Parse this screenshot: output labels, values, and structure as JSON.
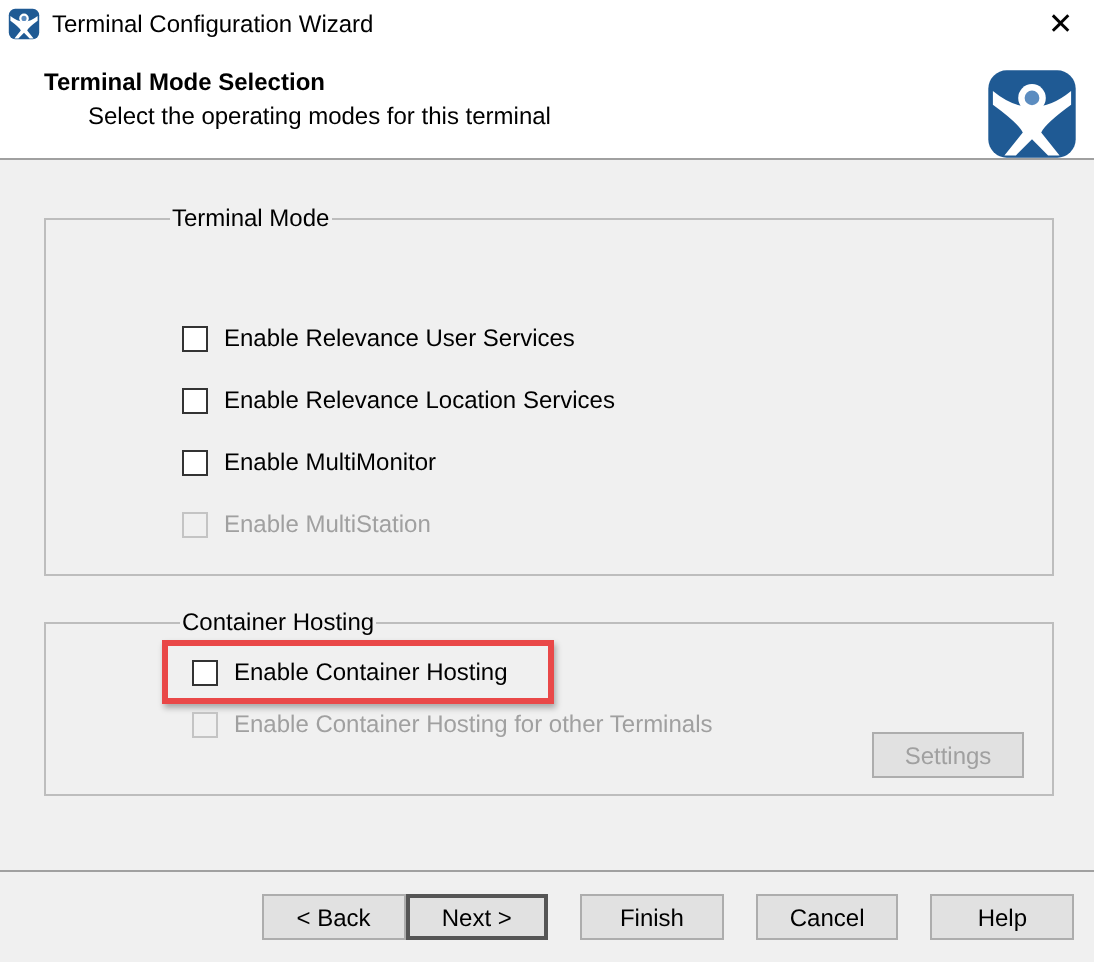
{
  "window": {
    "title": "Terminal Configuration Wizard",
    "close": "✕"
  },
  "header": {
    "title": "Terminal Mode Selection",
    "subtitle": "Select the operating modes for this terminal"
  },
  "groups": [
    {
      "title": "Terminal Mode",
      "options": [
        {
          "label": "Enable Relevance User Services",
          "checked": false,
          "disabled": false,
          "highlighted": false
        },
        {
          "label": "Enable Relevance Location Services",
          "checked": false,
          "disabled": false,
          "highlighted": false
        },
        {
          "label": "Enable MultiMonitor",
          "checked": false,
          "disabled": false,
          "highlighted": false
        },
        {
          "label": "Enable MultiStation",
          "checked": false,
          "disabled": true,
          "highlighted": false
        }
      ]
    },
    {
      "title": "Container Hosting",
      "options": [
        {
          "label": "Enable Container Hosting",
          "checked": false,
          "disabled": false,
          "highlighted": true
        },
        {
          "label": "Enable Container Hosting for other Terminals",
          "checked": false,
          "disabled": true,
          "highlighted": false
        }
      ],
      "buttons": [
        {
          "label": "Settings",
          "disabled": true
        }
      ]
    }
  ],
  "buttons": [
    {
      "label": "< Back",
      "default": false,
      "gap_after": false
    },
    {
      "label": "Next >",
      "default": true,
      "gap_after": true
    },
    {
      "label": "Finish",
      "default": false,
      "gap_after": true
    },
    {
      "label": "Cancel",
      "default": false,
      "gap_after": true
    },
    {
      "label": "Help",
      "default": false,
      "gap_after": false
    }
  ]
}
